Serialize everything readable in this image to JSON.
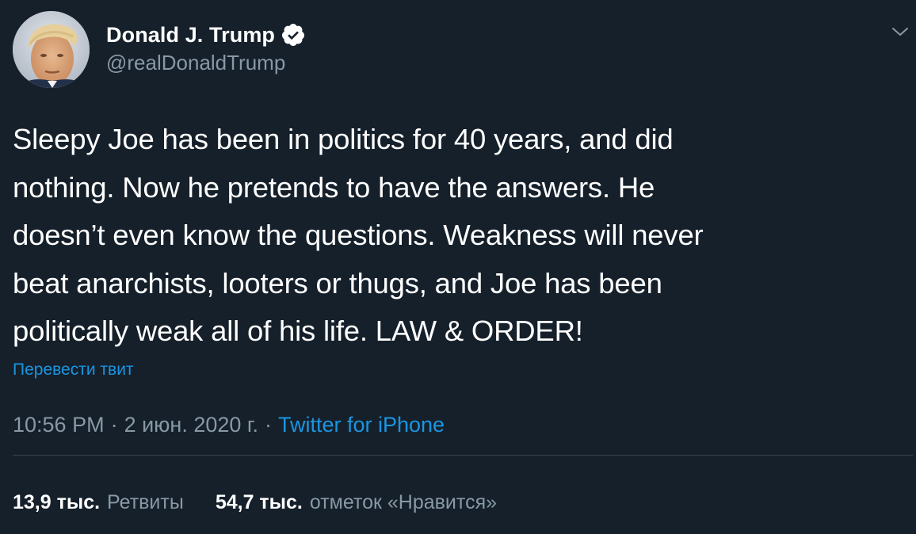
{
  "author": {
    "display_name": "Donald J. Trump",
    "handle": "@realDonaldTrump",
    "verified": true
  },
  "tweet": {
    "text": "Sleepy Joe has been in politics for 40 years, and did\nnothing. Now he pretends to have the answers. He\ndoesn’t even know the questions. Weakness will never\nbeat anarchists, looters or thugs, and Joe has been\npolitically weak all of his life. LAW & ORDER!",
    "translate_label": "Перевести твит"
  },
  "meta": {
    "time": "10:56 PM",
    "separator": "·",
    "date": "2 июн. 2020 г.",
    "source": "Twitter for iPhone"
  },
  "stats": {
    "retweets_count": "13,9 тыс.",
    "retweets_label": "Ретвиты",
    "likes_count": "54,7 тыс.",
    "likes_label": "отметок «Нравится»"
  },
  "icons": {
    "verified": "verified-badge-icon",
    "menu": "chevron-down-icon"
  },
  "colors": {
    "background": "#15202b",
    "text_primary": "#ffffff",
    "text_secondary": "#8899a6",
    "link": "#1b95e0",
    "divider": "#38444d"
  }
}
